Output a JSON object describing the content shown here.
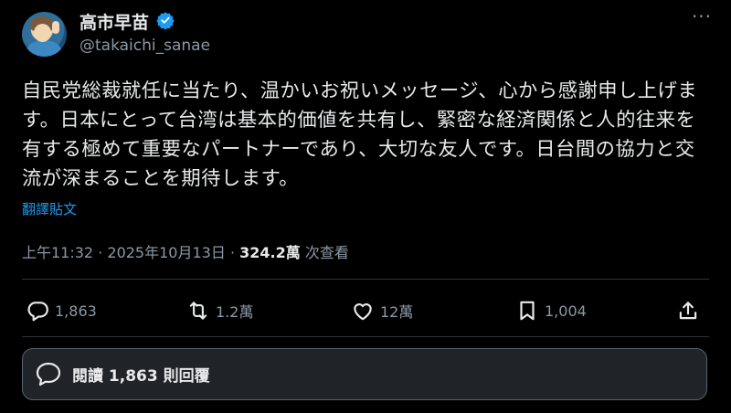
{
  "author": {
    "display_name": "高市早苗",
    "handle": "@takaichi_sanae",
    "verified": true
  },
  "tweet": {
    "text": "自民党総裁就任に当たり、温かいお祝いメッセージ、心から感謝申し上げます。日本にとって台湾は基本的価値を共有し、緊密な経済関係と人的往来を有する極めて重要なパートナーであり、大切な友人です。日台間の協力と交流が深まることを期待します。",
    "translate_label": "翻譯貼文"
  },
  "meta": {
    "time": "上午11:32",
    "date": "2025年10月13日",
    "views": "324.2萬",
    "views_label": "次查看"
  },
  "actions": {
    "replies": "1,863",
    "retweets": "1.2萬",
    "likes": "12萬",
    "bookmarks": "1,004"
  },
  "read_replies_label": "閱讀 1,863 則回覆",
  "colors": {
    "background": "#000000",
    "text": "#e7e9ea",
    "secondary": "#8b98a5",
    "link": "#1d9bf0",
    "verified": "#1d9bf0"
  },
  "icons": [
    "more-icon",
    "verified-badge-icon",
    "reply-icon",
    "retweet-icon",
    "like-icon",
    "bookmark-icon",
    "share-icon",
    "speech-bubble-icon"
  ]
}
